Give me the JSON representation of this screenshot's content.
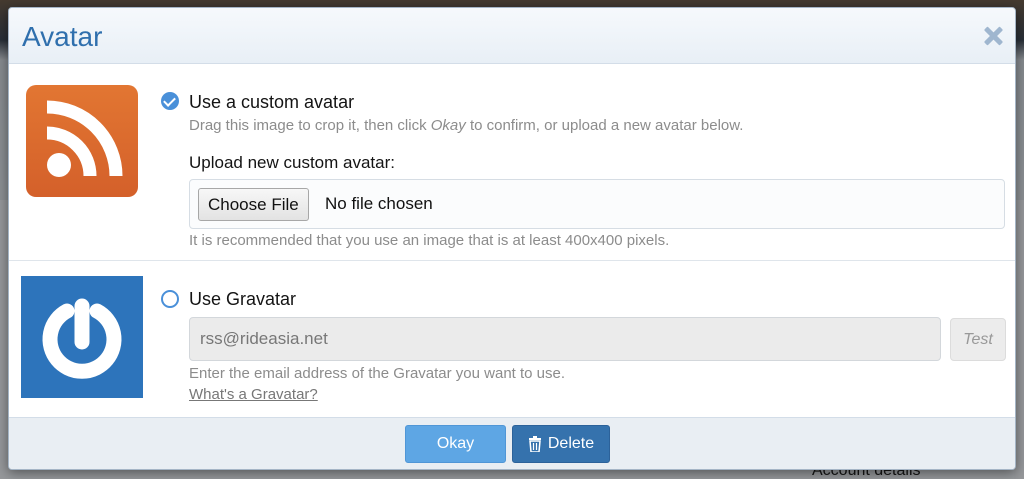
{
  "background": {
    "account_text": "Account details"
  },
  "dialog": {
    "title": "Avatar",
    "close_icon": "close-icon"
  },
  "custom_avatar": {
    "option_label": "Use a custom avatar",
    "selected": true,
    "hint_prefix": "Drag this image to crop it, then click ",
    "hint_emphasis": "Okay",
    "hint_suffix": " to confirm, or upload a new avatar below.",
    "upload_label": "Upload new custom avatar:",
    "choose_file_label": "Choose File",
    "no_file_text": "No file chosen",
    "recommendation": "It is recommended that you use an image that is at least 400x400 pixels.",
    "preview_icon": "rss-feed-icon"
  },
  "gravatar": {
    "option_label": "Use Gravatar",
    "selected": false,
    "email_value": "rss@rideasia.net",
    "test_label": "Test",
    "hint": "Enter the email address of the Gravatar you want to use.",
    "link_text": "What's a Gravatar?",
    "preview_icon": "gravatar-logo-icon"
  },
  "footer": {
    "okay_label": "Okay",
    "delete_label": "Delete",
    "delete_icon": "trash-icon"
  },
  "colors": {
    "title_blue": "#2f6fad",
    "radio_blue": "#4a90d9",
    "okay_button": "#5ea6e4",
    "delete_button": "#3572ad",
    "rss_orange": "#dd6a2e",
    "gravatar_blue": "#2d74bb"
  }
}
